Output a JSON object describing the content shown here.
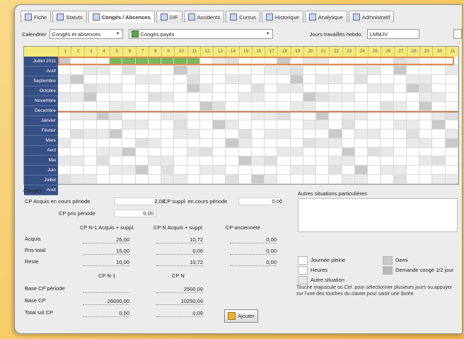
{
  "tabs": [
    {
      "label": "Fiche",
      "icon": "card-icon"
    },
    {
      "label": "Statuts",
      "icon": "status-icon"
    },
    {
      "label": "Congés / Absences",
      "icon": "calendar-icon",
      "active": true
    },
    {
      "label": "DIF",
      "icon": "training-icon"
    },
    {
      "label": "Accidents",
      "icon": "accident-icon"
    },
    {
      "label": "Cursus",
      "icon": "cursus-icon"
    },
    {
      "label": "Historique",
      "icon": "history-icon"
    },
    {
      "label": "Analytique",
      "icon": "analytics-icon"
    },
    {
      "label": "Admnistratif",
      "icon": "admin-icon"
    }
  ],
  "toolbar": {
    "calendar_label": "Calendrier",
    "calendar_value": "Congés et absences",
    "type_value": "Congés payés",
    "working_days_label": "Jours travaillés hebdo.",
    "working_days_value": "LMMJV"
  },
  "calendar": {
    "month_row_label": "Juillet 2011",
    "months": [
      "Juillet",
      "Août",
      "Septembre",
      "Octobre",
      "Novembre",
      "Décembre",
      "Janvier",
      "Février",
      "Mars",
      "Avril",
      "Mai",
      "Juin",
      "Juillet",
      "Août"
    ],
    "day_numbers": [
      "1",
      "2",
      "3",
      "4",
      "5",
      "6",
      "7",
      "8",
      "9",
      "10",
      "11",
      "12",
      "13",
      "14",
      "15",
      "16",
      "17",
      "18",
      "19",
      "20",
      "21",
      "22",
      "23",
      "24",
      "25",
      "26",
      "27",
      "28",
      "29",
      "30",
      "31"
    ]
  },
  "conges": {
    "section_label": "Congés",
    "cp_acquis_label": "CP Acquis en cours période",
    "cp_acquis_value": "2,08",
    "cp_suppl_label": "CP suppl. en cours période",
    "cp_suppl_value": "0,00",
    "cp_pris_label": "CP pris période",
    "cp_pris_value": "0,00",
    "col_headers": [
      "CP N-1 Acquis + suppl.",
      "CP N Acquis + suppl.",
      "CP anciennété"
    ],
    "rows": [
      {
        "label": "Acquis",
        "values": [
          "25,00",
          "10,72",
          "0,00"
        ]
      },
      {
        "label": "Pris total",
        "values": [
          "15,00",
          "0,00",
          "0,00"
        ]
      },
      {
        "label": "Reste",
        "values": [
          "10,00",
          "10,72",
          "0,00"
        ]
      }
    ],
    "sub_headers": [
      "CP N-1",
      "CP N"
    ],
    "base_periode_label": "Base CP période",
    "base_periode_values": [
      "",
      "2500,00"
    ],
    "base_cp_label": "Base CP",
    "base_cp_values": [
      "26000,00",
      "10250,00"
    ],
    "total_label": "Total sol CP",
    "total_values": [
      "0,00",
      "0,00"
    ],
    "ajouter_label": "Ajouter"
  },
  "situations": {
    "label": "Autres situations particulières",
    "notes": ""
  },
  "legend": {
    "items": [
      {
        "label": "Journée pleine",
        "color": "#ffffff"
      },
      {
        "label": "Demi",
        "color": "#c9c9c9"
      },
      {
        "label": "Heures",
        "color": "#ffffff"
      },
      {
        "label": "Demande congé 1/2 jour",
        "color": "#b8b8b8"
      },
      {
        "label": "Autre situation",
        "color": "#e6e6e6"
      }
    ],
    "hint": "Touche majuscule ou Ctrl. pour sélectionner plusieurs jours ou appuyer sur l'une des touches du clavier pour saisir une durée"
  },
  "colors": {
    "header_yellow": "#f3e97c",
    "row_label_blue": "#364f84",
    "highlight_orange": "#e38a4a",
    "green_range": "#79b85c"
  }
}
